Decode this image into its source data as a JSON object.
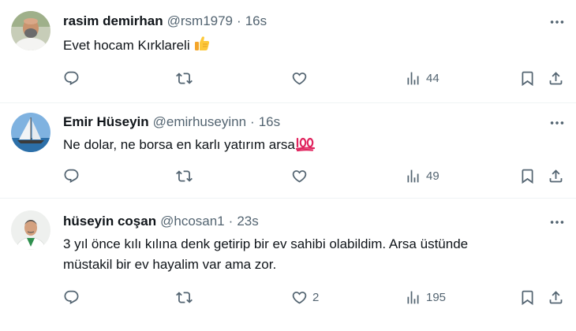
{
  "tweets": [
    {
      "name": "rasim demirhan",
      "handle": "@rsm1979",
      "sep": "·",
      "time": "16s",
      "text": "Evet hocam Kırklareli",
      "text_emoji": "thumbs-up-emoji",
      "views": "44",
      "likes": ""
    },
    {
      "name": "Emir Hüseyin",
      "handle": "@emirhuseyinn",
      "sep": "·",
      "time": "16s",
      "text": "Ne dolar, ne borsa en karlı yatırım arsa",
      "text_emoji": "hundred-points-emoji",
      "views": "49",
      "likes": ""
    },
    {
      "name": "hüseyin coşan",
      "handle": "@hcosan1",
      "sep": "·",
      "time": "23s",
      "text_line1": "3 yıl önce kılı kılına denk getirip bir ev sahibi olabildim. Arsa üstünde",
      "text_line2": "müstakil bir ev hayalim var ama zor.",
      "views": "195",
      "likes": "2"
    }
  ],
  "colors": {
    "text_primary": "#0f1419",
    "text_secondary": "#536471",
    "divider": "#eff3f4"
  },
  "icons": [
    "more-icon",
    "reply-icon",
    "retweet-icon",
    "like-icon",
    "views-icon",
    "bookmark-icon",
    "share-icon"
  ]
}
